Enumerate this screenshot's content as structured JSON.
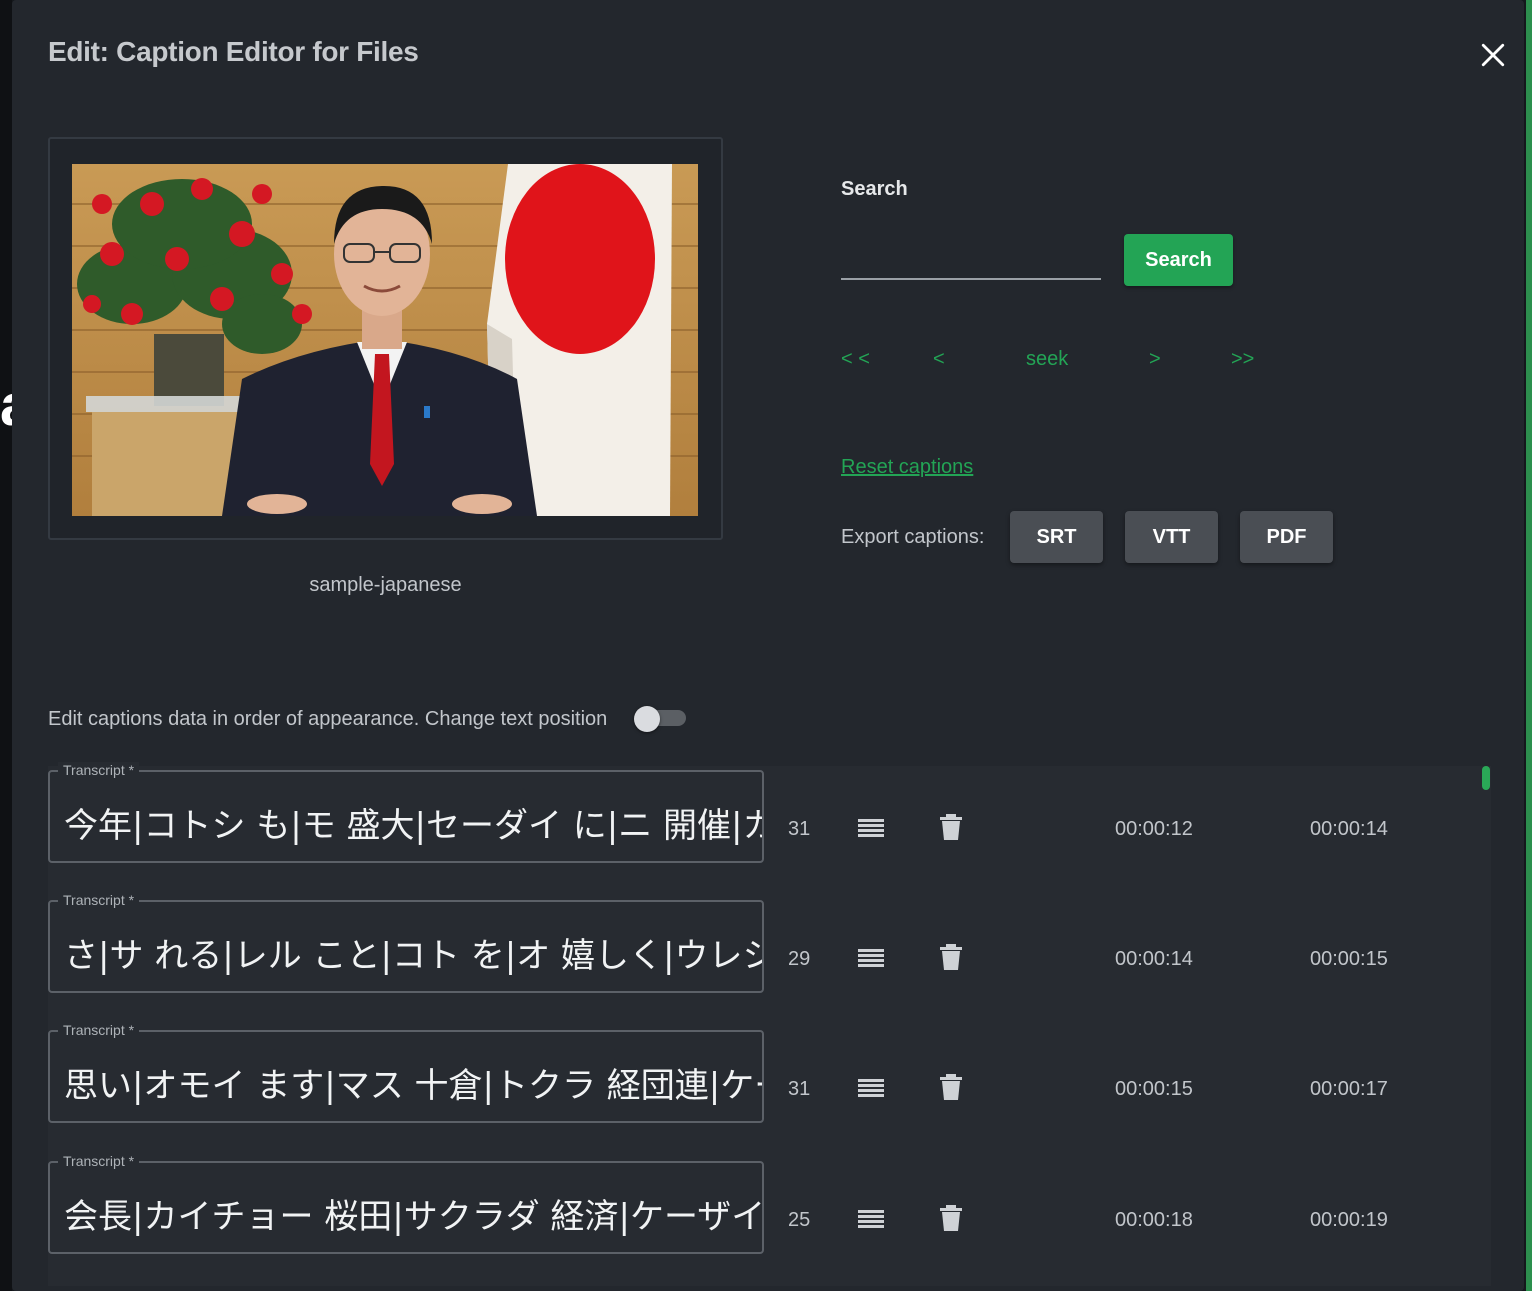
{
  "backdrop": {
    "letter": "a"
  },
  "modal": {
    "title": "Edit: Caption Editor for Files"
  },
  "video": {
    "name": "sample-japanese"
  },
  "search": {
    "label": "Search",
    "input_value": "",
    "button_label": "Search"
  },
  "seek_nav": {
    "first": "< <",
    "prev": "<",
    "seek": "seek",
    "next": ">",
    "last": ">>"
  },
  "reset_captions": "Reset captions",
  "export": {
    "label": "Export captions:",
    "formats": [
      "SRT",
      "VTT",
      "PDF"
    ]
  },
  "toggle": {
    "label": "Edit captions data in order of appearance. Change text position",
    "on": false
  },
  "captions": [
    {
      "legend": "Transcript *",
      "text": "今年|コトシ も|モ 盛大|セーダイ に|ニ 開催|カイサイ",
      "count": "31",
      "start": "00:00:12",
      "end": "00:00:14"
    },
    {
      "legend": "Transcript *",
      "text": "さ|サ れる|レル こと|コト を|オ 嬉しく|ウレシク",
      "count": "29",
      "start": "00:00:14",
      "end": "00:00:15"
    },
    {
      "legend": "Transcript *",
      "text": "思い|オモイ ます|マス 十倉|トクラ 経団連|ケーダンレン",
      "count": "31",
      "start": "00:00:15",
      "end": "00:00:17"
    },
    {
      "legend": "Transcript *",
      "text": "会長|カイチョー 桜田|サクラダ 経済|ケーザイ",
      "count": "25",
      "start": "00:00:18",
      "end": "00:00:19"
    }
  ],
  "colors": {
    "accent_green": "#23a455",
    "modal_bg": "#23272d",
    "panel_bg": "#272b31"
  },
  "icons": [
    "close-icon",
    "drag-handle-icon",
    "trash-icon"
  ]
}
